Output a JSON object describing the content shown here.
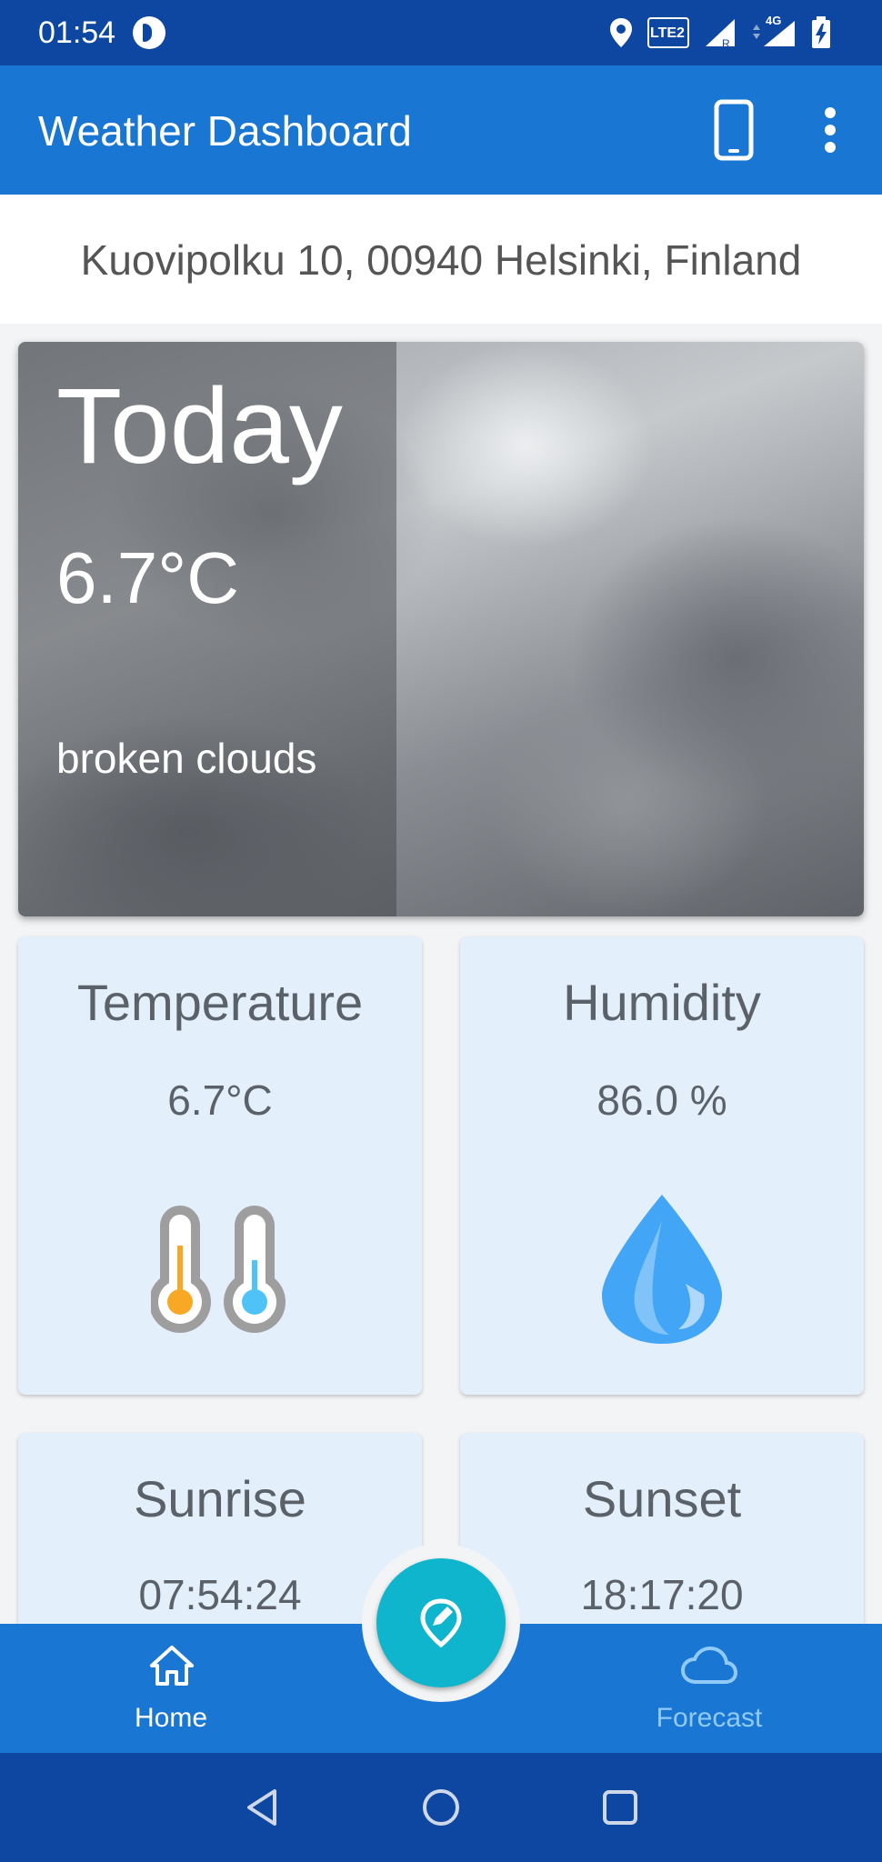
{
  "status_bar": {
    "time": "01:54",
    "network_badge": "LTE2",
    "signal_label": "4G",
    "icons": [
      "app-icon",
      "location-icon",
      "volte-icon",
      "signal-icon",
      "signal-4g-icon",
      "battery-charging-icon"
    ]
  },
  "app_bar": {
    "title": "Weather Dashboard",
    "actions": [
      "phone-icon",
      "more-vert-icon"
    ]
  },
  "location": {
    "address": "Kuovipolku 10, 00940 Helsinki, Finland"
  },
  "today": {
    "label": "Today",
    "temperature": "6.7°C",
    "description": "broken clouds",
    "background": "cloudy-sky-image"
  },
  "cards": {
    "temperature": {
      "title": "Temperature",
      "value": "6.7°C",
      "icon": "thermometer-icon"
    },
    "humidity": {
      "title": "Humidity",
      "value": "86.0 %",
      "icon": "water-drop-icon"
    },
    "sunrise": {
      "title": "Sunrise",
      "value": "07:54:24"
    },
    "sunset": {
      "title": "Sunset",
      "value": "18:17:20"
    }
  },
  "bottom_nav": {
    "items": [
      {
        "label": "Home",
        "icon": "home-icon",
        "active": true
      },
      {
        "label": "Forecast",
        "icon": "cloud-icon",
        "active": false
      }
    ],
    "fab_icon": "edit-location-icon"
  },
  "colors": {
    "status_bar": "#0d47a1",
    "app_bar": "#1976d2",
    "card_bg": "#e3effb",
    "fab": "#0fb5cc",
    "text_gray": "#5b6168",
    "inactive_nav": "#90caf9"
  }
}
